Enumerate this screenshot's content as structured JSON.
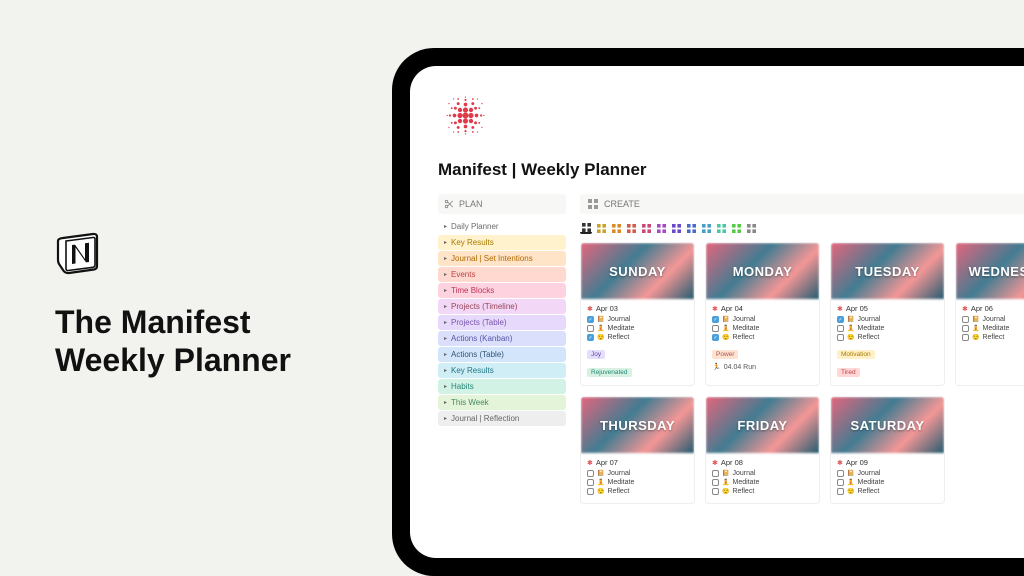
{
  "promo": {
    "title_line1": "The Manifest",
    "title_line2": "Weekly Planner"
  },
  "page": {
    "title": "Manifest | Weekly Planner"
  },
  "sidebar": {
    "header": "PLAN",
    "items": [
      {
        "label": "Daily Planner",
        "bg": "#ffffff",
        "color": "#6b6b6b"
      },
      {
        "label": "Key Results",
        "bg": "#fff2cc",
        "color": "#a87b00"
      },
      {
        "label": "Journal | Set Intentions",
        "bg": "#ffe4c7",
        "color": "#b06a00"
      },
      {
        "label": "Events",
        "bg": "#ffd9d0",
        "color": "#b44"
      },
      {
        "label": "Time Blocks",
        "bg": "#ffd2e0",
        "color": "#b35"
      },
      {
        "label": "Projects (Timeline)",
        "bg": "#f2d7f7",
        "color": "#945"
      },
      {
        "label": "Projects (Table)",
        "bg": "#e7d9fb",
        "color": "#75a"
      },
      {
        "label": "Actions (Kanban)",
        "bg": "#dcdffb",
        "color": "#55a"
      },
      {
        "label": "Actions (Table)",
        "bg": "#d3e5fb",
        "color": "#357"
      },
      {
        "label": "Key Results",
        "bg": "#cfeef5",
        "color": "#278"
      },
      {
        "label": "Habits",
        "bg": "#d3f2e6",
        "color": "#287"
      },
      {
        "label": "This Week",
        "bg": "#e3f4d8",
        "color": "#486"
      },
      {
        "label": "Journal | Reflection",
        "bg": "#eeeeee",
        "color": "#666"
      }
    ]
  },
  "create": {
    "header": "CREATE"
  },
  "view_tabs": [
    {
      "color": "#333",
      "active": true
    },
    {
      "color": "#c9a227"
    },
    {
      "color": "#d88b2a"
    },
    {
      "color": "#d25b4a"
    },
    {
      "color": "#c94a7a"
    },
    {
      "color": "#a44ac9"
    },
    {
      "color": "#6a4ac9"
    },
    {
      "color": "#4a6ac9"
    },
    {
      "color": "#4a9fc9"
    },
    {
      "color": "#4ac9a0"
    },
    {
      "color": "#5ac94a"
    },
    {
      "color": "#888"
    }
  ],
  "days": [
    {
      "name": "SUNDAY",
      "date": "Apr 03",
      "tasks": [
        {
          "label": "Journal",
          "icon": "📔",
          "checked": true
        },
        {
          "label": "Meditate",
          "icon": "🧘",
          "checked": false
        },
        {
          "label": "Reflect",
          "icon": "😌",
          "checked": true
        }
      ],
      "tags": [
        {
          "label": "Joy",
          "bg": "#e5dffb",
          "color": "#64a"
        },
        {
          "label": "Rejuvenated",
          "bg": "#d7f2e3",
          "color": "#287"
        }
      ]
    },
    {
      "name": "MONDAY",
      "date": "Apr 04",
      "tasks": [
        {
          "label": "Journal",
          "icon": "📔",
          "checked": true
        },
        {
          "label": "Meditate",
          "icon": "🧘",
          "checked": false
        },
        {
          "label": "Reflect",
          "icon": "😌",
          "checked": true
        }
      ],
      "tags": [
        {
          "label": "Power",
          "bg": "#ffe2cf",
          "color": "#a55"
        }
      ],
      "extra": {
        "icon": "🏃",
        "label": "04.04 Run"
      }
    },
    {
      "name": "TUESDAY",
      "date": "Apr 05",
      "tasks": [
        {
          "label": "Journal",
          "icon": "📔",
          "checked": true
        },
        {
          "label": "Meditate",
          "icon": "🧘",
          "checked": false
        },
        {
          "label": "Reflect",
          "icon": "😌",
          "checked": false
        }
      ],
      "tags": [
        {
          "label": "Motivation",
          "bg": "#fff0c8",
          "color": "#a87b00"
        },
        {
          "label": "Tired",
          "bg": "#ffd7d7",
          "color": "#b44"
        }
      ]
    },
    {
      "name": "WEDNESDAY",
      "date": "Apr 06",
      "tasks": [
        {
          "label": "Journal",
          "icon": "📔",
          "checked": false
        },
        {
          "label": "Meditate",
          "icon": "🧘",
          "checked": false
        },
        {
          "label": "Reflect",
          "icon": "😌",
          "checked": false
        }
      ],
      "tags": []
    },
    {
      "name": "THURSDAY",
      "date": "Apr 07",
      "tasks": [
        {
          "label": "Journal",
          "icon": "📔",
          "checked": false
        },
        {
          "label": "Meditate",
          "icon": "🧘",
          "checked": false
        },
        {
          "label": "Reflect",
          "icon": "😌",
          "checked": false
        }
      ],
      "tags": []
    },
    {
      "name": "FRIDAY",
      "date": "Apr 08",
      "tasks": [
        {
          "label": "Journal",
          "icon": "📔",
          "checked": false
        },
        {
          "label": "Meditate",
          "icon": "🧘",
          "checked": false
        },
        {
          "label": "Reflect",
          "icon": "😌",
          "checked": false
        }
      ],
      "tags": []
    },
    {
      "name": "SATURDAY",
      "date": "Apr 09",
      "tasks": [
        {
          "label": "Journal",
          "icon": "📔",
          "checked": false
        },
        {
          "label": "Meditate",
          "icon": "🧘",
          "checked": false
        },
        {
          "label": "Reflect",
          "icon": "😌",
          "checked": false
        }
      ],
      "tags": []
    }
  ]
}
